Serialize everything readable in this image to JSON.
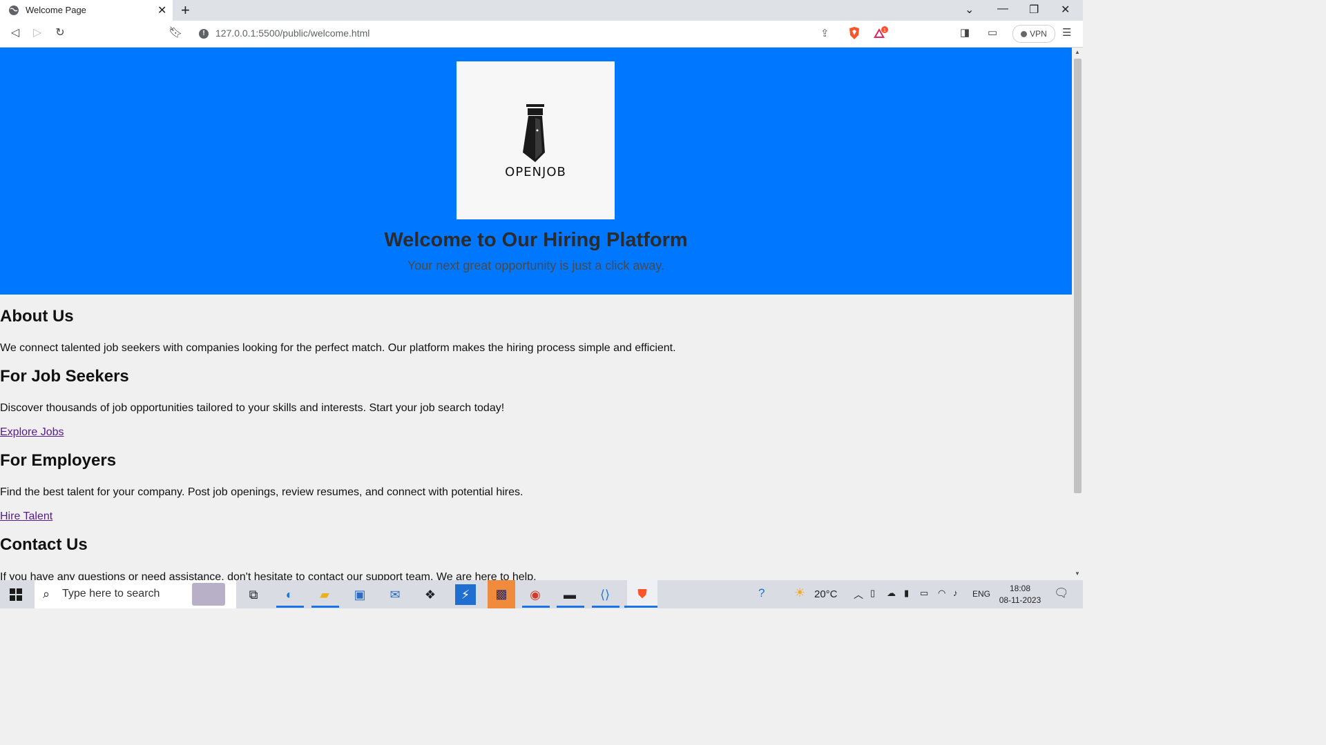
{
  "browser": {
    "tab_title": "Welcome Page",
    "url": "127.0.0.1:5500/public/welcome.html",
    "vpn_label": "VPN",
    "rewards_badge": "1"
  },
  "hero": {
    "logo_text": "OPENJOB",
    "heading": "Welcome to Our Hiring Platform",
    "tagline": "Your next great opportunity is just a click away."
  },
  "sections": {
    "about": {
      "heading": "About Us",
      "text": "We connect talented job seekers with companies looking for the perfect match. Our platform makes the hiring process simple and efficient."
    },
    "seekers": {
      "heading": "For Job Seekers",
      "text": "Discover thousands of job opportunities tailored to your skills and interests. Start your job search today!",
      "link": "Explore Jobs"
    },
    "employers": {
      "heading": "For Employers",
      "text": "Find the best talent for your company. Post job openings, review resumes, and connect with potential hires.",
      "link": "Hire Talent"
    },
    "contact": {
      "heading": "Contact Us",
      "text": "If you have any questions or need assistance, don't hesitate to contact our support team. We are here to help."
    }
  },
  "taskbar": {
    "search_placeholder": "Type here to search",
    "weather": "20°C",
    "language": "ENG",
    "time": "18:08",
    "date": "08-11-2023"
  },
  "colors": {
    "hero_bg": "#0077ff",
    "link": "#551a8b"
  }
}
